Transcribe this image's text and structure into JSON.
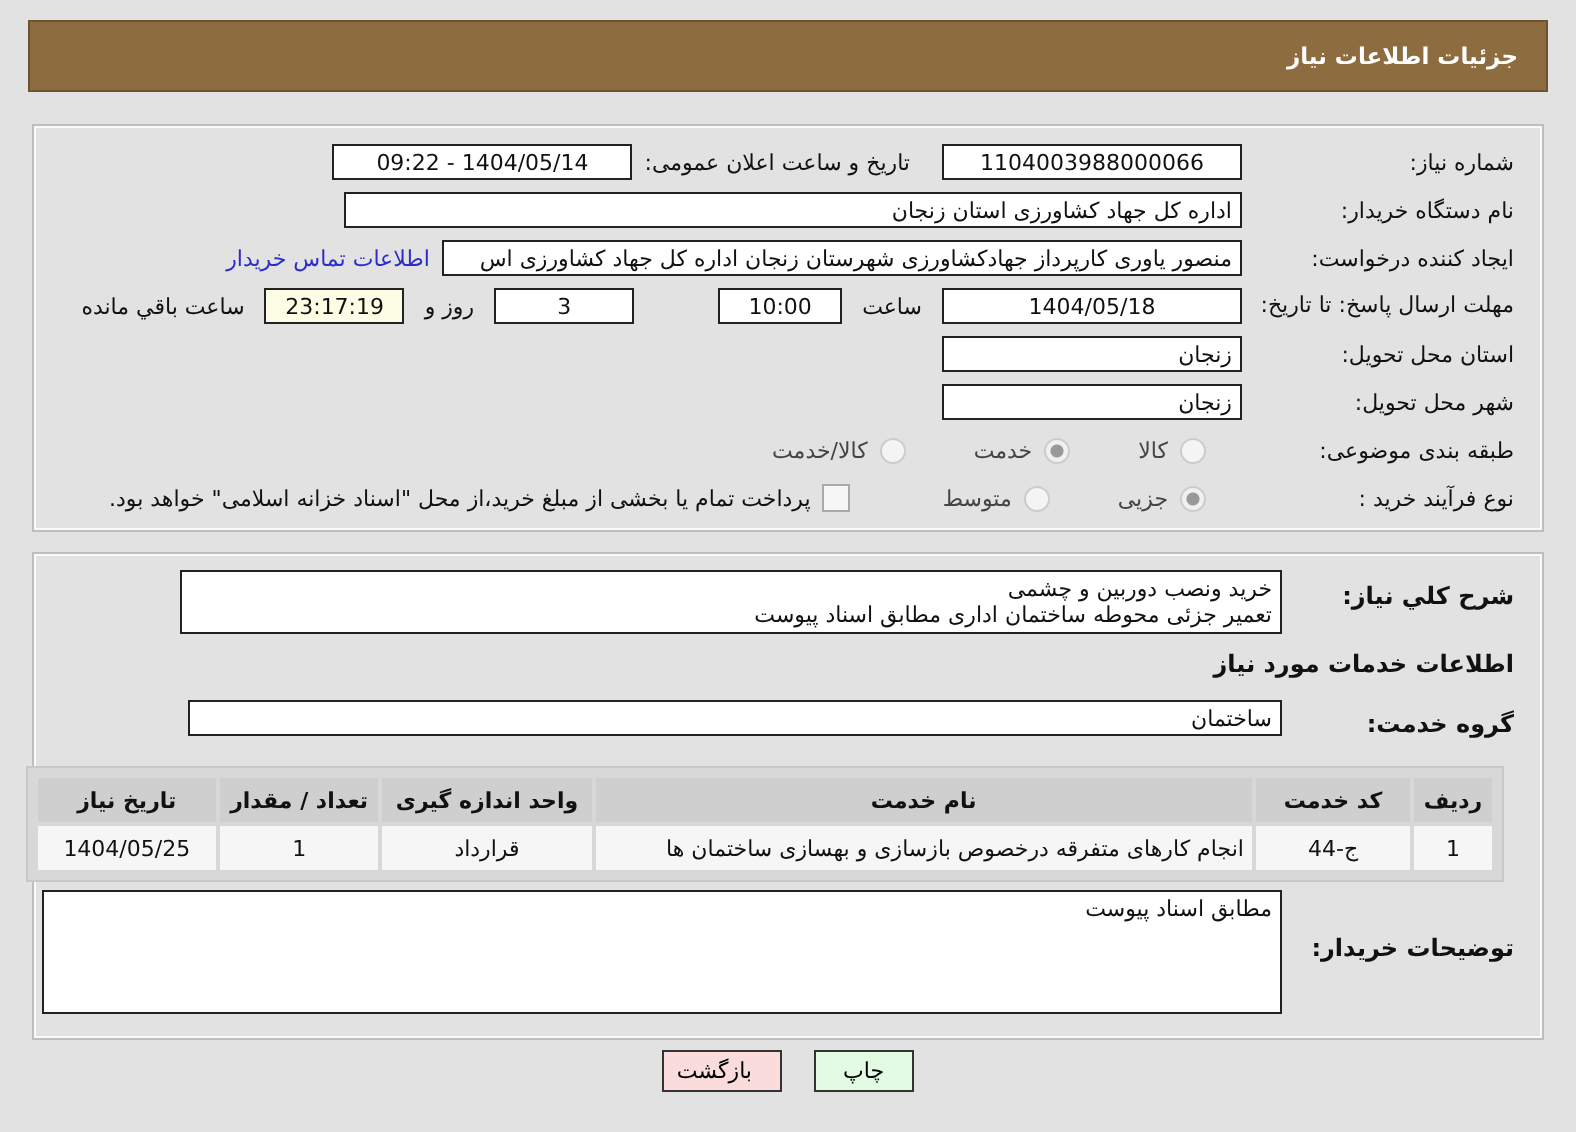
{
  "header": {
    "title": "جزئیات اطلاعات نیاز"
  },
  "details": {
    "need_number": {
      "label": "شماره نیاز:",
      "value": "1104003988000066"
    },
    "announce": {
      "label": "تاریخ و ساعت اعلان عمومی:",
      "value": "1404/05/14 - 09:22"
    },
    "buyer_org": {
      "label": "نام دستگاه خریدار:",
      "value": "اداره کل جهاد کشاورزی استان زنجان"
    },
    "creator": {
      "label": "ایجاد کننده درخواست:",
      "value": "منصور یاوری کارپرداز جهادکشاورزی شهرستان زنجان اداره کل جهاد کشاورزی اس",
      "link": "اطلاعات تماس خریدار"
    },
    "deadline": {
      "label": "مهلت ارسال پاسخ: تا تاریخ:",
      "date": "1404/05/18",
      "time_label": "ساعت",
      "time": "10:00",
      "days": "3",
      "days_label": "روز و",
      "remaining": "23:17:19",
      "remaining_label": "ساعت باقي مانده"
    },
    "province": {
      "label": "استان محل تحویل:",
      "value": "زنجان"
    },
    "city": {
      "label": "شهر محل تحویل:",
      "value": "زنجان"
    },
    "category": {
      "label": "طبقه بندی موضوعی:",
      "disabled": true,
      "options": [
        {
          "label": "کالا",
          "selected": false
        },
        {
          "label": "خدمت",
          "selected": true
        },
        {
          "label": "کالا/خدمت",
          "selected": false
        }
      ]
    },
    "process": {
      "label": "نوع فرآیند خرید :",
      "disabled": true,
      "options": [
        {
          "label": "جزیی",
          "selected": true
        },
        {
          "label": "متوسط",
          "selected": false
        }
      ],
      "treasury": {
        "label": "پرداخت تمام یا بخشی از مبلغ خرید،از محل \"اسناد خزانه اسلامی\" خواهد بود.",
        "checked": false
      }
    }
  },
  "services": {
    "summary": {
      "label": "شرح کلي نیاز:",
      "lines": [
        "خرید ونصب دوربین و چشمی",
        "تعمیر جزئی محوطه ساختمان اداری مطابق اسناد پیوست"
      ]
    },
    "heading": "اطلاعات خدمات مورد نیاز",
    "group": {
      "label": "گروه خدمت:",
      "value": "ساختمان"
    },
    "table": {
      "columns": [
        "ردیف",
        "کد خدمت",
        "نام خدمت",
        "واحد اندازه گیری",
        "تعداد / مقدار",
        "تاریخ نیاز"
      ],
      "rows": [
        [
          "1",
          "ج-44",
          "انجام کارهای متفرقه درخصوص بازسازی و بهسازی ساختمان ها",
          "قرارداد",
          "1",
          "1404/05/25"
        ]
      ]
    },
    "notes": {
      "label": "توضیحات خریدار:",
      "value": "مطابق اسناد پیوست"
    }
  },
  "buttons": [
    {
      "label": "چاپ",
      "kind": "print"
    },
    {
      "label": "بازگشت",
      "kind": "back"
    }
  ]
}
